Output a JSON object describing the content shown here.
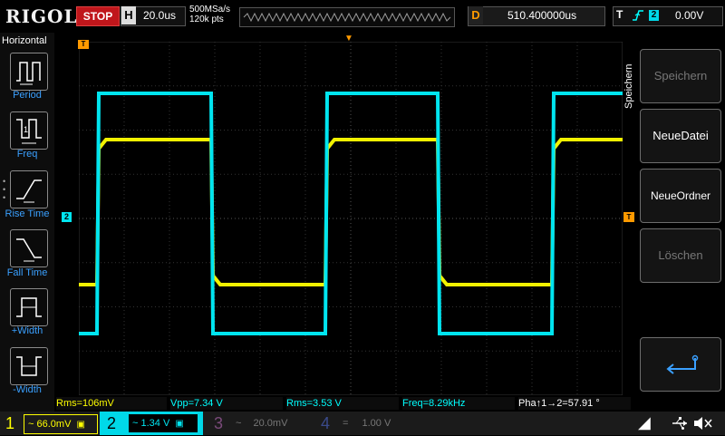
{
  "topbar": {
    "logo": "RIGOL",
    "run_state": "STOP",
    "horizontal_key": "H",
    "timebase": "20.0us",
    "sample_rate": "500MSa/s",
    "memory_depth": "120k pts",
    "delay_key": "D",
    "delay_value": "510.400000us",
    "trigger_key": "T",
    "trigger_source": "2",
    "trigger_level": "0.00V"
  },
  "left_panel": {
    "title": "Horizontal",
    "buttons": [
      {
        "label": "Period"
      },
      {
        "label": "Freq"
      },
      {
        "label": "Rise Time"
      },
      {
        "label": "Fall Time"
      },
      {
        "label": "+Width"
      },
      {
        "label": "-Width"
      }
    ]
  },
  "right_panel": {
    "title": "Speichern",
    "buttons": [
      {
        "label": "Speichern",
        "enabled": false
      },
      {
        "label": "NeueDatei",
        "enabled": true
      },
      {
        "label": "NeueOrdner",
        "enabled": true
      },
      {
        "label": "Löschen",
        "enabled": false
      }
    ],
    "enter_icon": "return-arrow-icon"
  },
  "markers": {
    "trigger_pos_marker": "T",
    "ch2_marker": "2",
    "trigger_level_marker": "T"
  },
  "measurements": [
    {
      "text": "Rms=106mV",
      "color": "#ffff00"
    },
    {
      "text": "Vpp=7.34 V",
      "color": "#00ffff"
    },
    {
      "text": "Rms=3.53 V",
      "color": "#00ffff"
    },
    {
      "text": "Freq=8.29kHz",
      "color": "#00ffff"
    },
    {
      "text": "Pha↑1→2=57.91 °",
      "color": "#ffffff"
    }
  ],
  "channels": [
    {
      "num": "1",
      "coupling": "~",
      "scale": "66.0mV",
      "color": "#ffff00",
      "active": true
    },
    {
      "num": "2",
      "coupling": "~",
      "scale": "1.34 V",
      "color": "#00ffff",
      "active": true
    },
    {
      "num": "3",
      "coupling": "~",
      "scale": "20.0mV",
      "color": "#b64db6",
      "active": false
    },
    {
      "num": "4",
      "coupling": "=",
      "scale": "1.00 V",
      "color": "#3a6cff",
      "active": false
    }
  ],
  "status_icons": [
    "usb-icon",
    "speaker-muted-icon"
  ],
  "colors": {
    "ch1": "#ffff00",
    "ch2": "#00e5f0",
    "grid": "#3a3a3a",
    "accent": "#ff9a00"
  }
}
